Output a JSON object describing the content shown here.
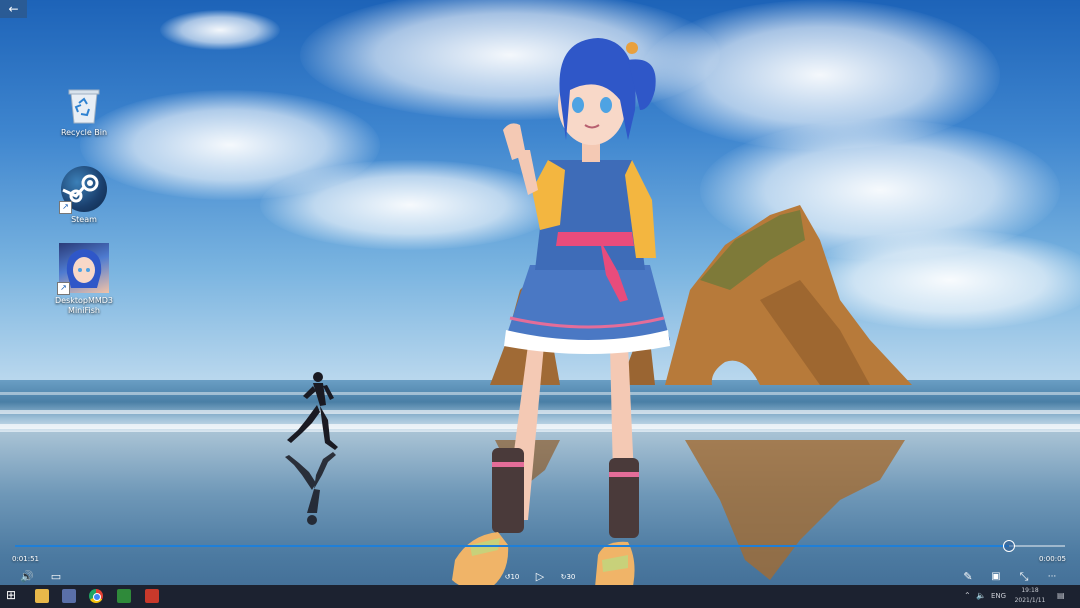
{
  "desktop": {
    "icons": [
      {
        "label": "Recycle Bin"
      },
      {
        "label": "Steam"
      },
      {
        "label": "DesktopMMD3 MiniFish"
      }
    ]
  },
  "back_button": {
    "icon": "back-arrow-icon",
    "glyph": "←"
  },
  "player": {
    "elapsed": "0:01:51",
    "remaining": "0:00:05",
    "progress_fraction": 0.947,
    "controls": {
      "volume_glyph": "🔊",
      "subtitles_glyph": "▭",
      "rewind_label": "10",
      "play_glyph": "▷",
      "forward_label": "30",
      "edit_glyph": "✎",
      "miniplayer_glyph": "▣",
      "fullscreen_glyph": "⤡",
      "more_glyph": "···"
    }
  },
  "taskbar": {
    "start_glyph": "⊞",
    "apps": [
      "file-explorer",
      "desktop-mmd",
      "chrome",
      "app-green",
      "app-red"
    ],
    "tray": {
      "chevron": "⌃",
      "volume": "🔈",
      "lang": "ENG",
      "time": "19:18",
      "date": "2021/1/11",
      "notification": "▤"
    }
  },
  "colors": {
    "accent": "#1f7fd8",
    "taskbar": "#1c2230"
  }
}
